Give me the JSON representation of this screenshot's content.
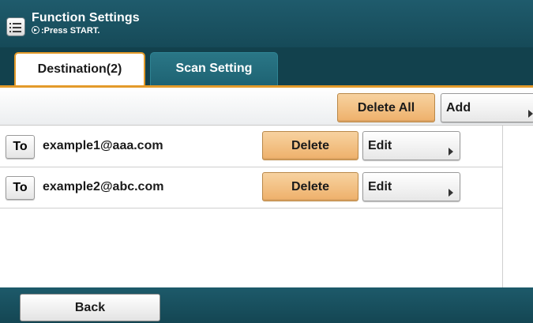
{
  "header": {
    "title": "Function Settings",
    "subtitle": ":Press START.",
    "start_icon": "start-icon",
    "menu_icon": "menu-list-icon"
  },
  "tabs": [
    {
      "label": "Destination(2)",
      "active": true
    },
    {
      "label": "Scan Setting",
      "active": false
    }
  ],
  "toolbar": {
    "delete_all_label": "Delete All",
    "add_label": "Add"
  },
  "destinations": [
    {
      "type_label": "To",
      "address": "example1@aaa.com",
      "delete_label": "Delete",
      "edit_label": "Edit"
    },
    {
      "type_label": "To",
      "address": "example2@abc.com",
      "delete_label": "Delete",
      "edit_label": "Edit"
    }
  ],
  "footer": {
    "back_label": "Back"
  },
  "colors": {
    "header_bg": "#1f5b6c",
    "accent_orange": "#e39a2a",
    "button_orange": "#f2c085"
  }
}
